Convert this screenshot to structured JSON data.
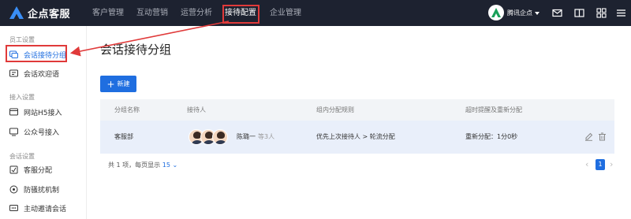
{
  "app": {
    "logo_text": "企点客服"
  },
  "topnav": {
    "items": [
      {
        "label": "客户管理"
      },
      {
        "label": "互动营销"
      },
      {
        "label": "运营分析"
      },
      {
        "label": "接待配置"
      },
      {
        "label": "企业管理"
      }
    ],
    "active_index": 3,
    "account_name": "腾讯企点"
  },
  "sidebar": {
    "groups": [
      {
        "title": "员工设置",
        "items": [
          {
            "label": "会话接待分组",
            "icon": "chat-group-icon",
            "active": true
          },
          {
            "label": "会话欢迎语",
            "icon": "welcome-message-icon"
          }
        ]
      },
      {
        "title": "接入设置",
        "items": [
          {
            "label": "网站H5接入",
            "icon": "web-h5-icon"
          },
          {
            "label": "公众号接入",
            "icon": "official-account-icon"
          }
        ]
      },
      {
        "title": "会话设置",
        "items": [
          {
            "label": "客服分配",
            "icon": "assignment-icon"
          },
          {
            "label": "防骚扰机制",
            "icon": "anti-harassment-icon"
          },
          {
            "label": "主动邀请会话",
            "icon": "invite-session-icon"
          }
        ]
      }
    ]
  },
  "main": {
    "title": "会话接待分组",
    "add_button": "新建",
    "table": {
      "headers": [
        "分组名称",
        "接待人",
        "组内分配规则",
        "超时提醒及重新分配"
      ],
      "rows": [
        {
          "group_name": "客服部",
          "reception_name": "陈璐一",
          "reception_more": "等3人",
          "rule": "优先上次接待人 > 轮流分配",
          "timeout": "重新分配：1分0秒"
        }
      ]
    },
    "pagination": {
      "summary": "共 1 项，每页显示",
      "page_size": "15",
      "current_page": "1"
    }
  },
  "colors": {
    "topbar": "#1d2230",
    "accent": "#1f6ee0",
    "highlight": "#e03a3a"
  }
}
